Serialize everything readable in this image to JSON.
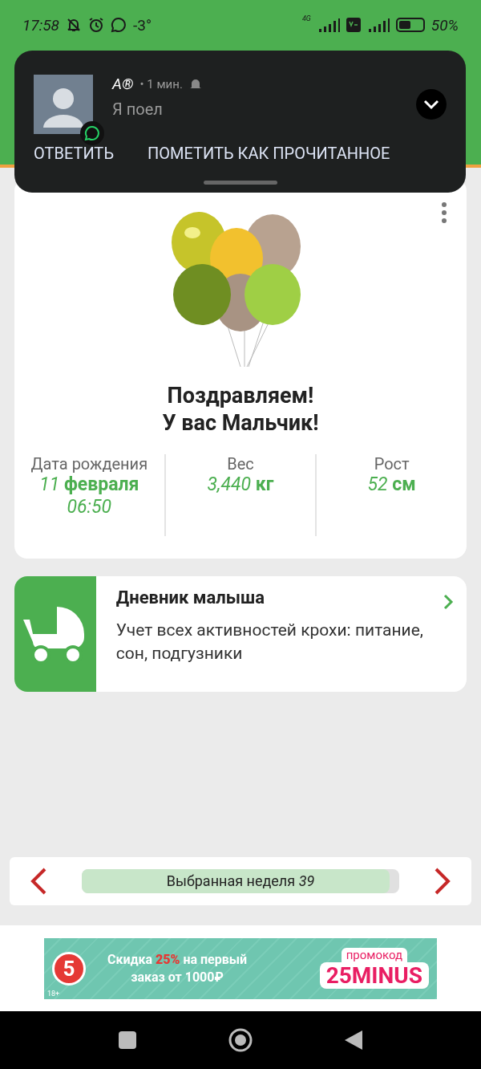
{
  "status_bar": {
    "time": "17:58",
    "temperature": "-3°",
    "network": "4G",
    "battery": "50%"
  },
  "notification": {
    "sender": "A®",
    "time": "• 1 мин.",
    "message": "Я поел",
    "actions": [
      "ОТВЕТИТЬ",
      "ПОМЕТИТЬ КАК ПРОЧИТАННОЕ"
    ]
  },
  "birth_card": {
    "title_lines": [
      "Поздравляем!",
      "У вас Мальчик!"
    ],
    "stats": [
      {
        "label": "Дата рождения",
        "values": [
          "*11* **февраля**",
          "*06:50*"
        ]
      },
      {
        "label": "Вес",
        "values": [
          "*3,440* **кг**"
        ]
      },
      {
        "label": "Рост",
        "values": [
          "*52* **см**"
        ]
      }
    ]
  },
  "diary_card": {
    "title": "Дневник малыша",
    "description": "Учет всех активностей крохи: питание, сон, подгузники"
  },
  "week_selector": {
    "label": "Выбранная неделя *39*",
    "level": 0.97
  },
  "ad_banner": {
    "logo": "5",
    "text": "Скидка **25%** на первый заказ от 1000₽",
    "promo_label": "промокод",
    "promo_code": "25MINUS",
    "age_mark": "18+"
  }
}
